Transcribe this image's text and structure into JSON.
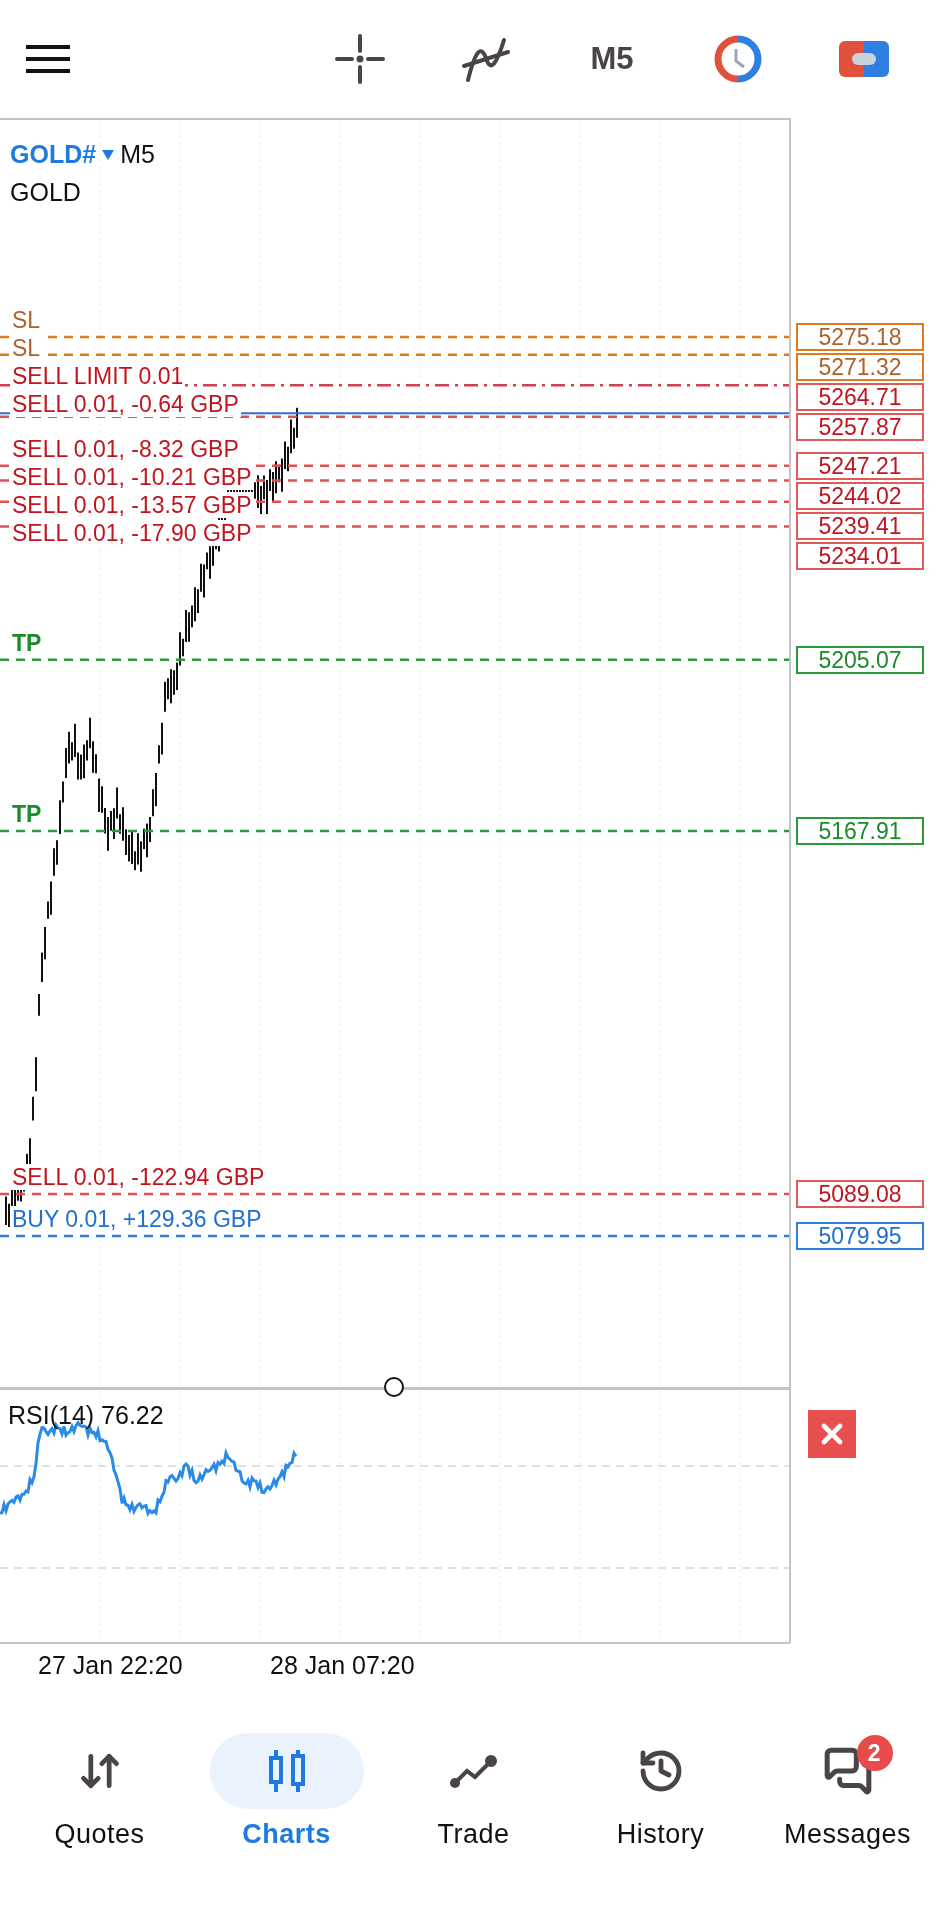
{
  "toolbar": {
    "timeframe": "M5"
  },
  "chart": {
    "symbol": "GOLD#",
    "timeframe": "M5",
    "description": "GOLD",
    "price_lines": [
      {
        "kind": "sl",
        "label": "SL",
        "price": "5275.18"
      },
      {
        "kind": "sl",
        "label": "SL",
        "price": "5271.32"
      },
      {
        "kind": "sell_limit",
        "label": "SELL LIMIT 0.01",
        "price": "5264.71"
      },
      {
        "kind": "sell",
        "label": "SELL 0.01,  -0.64 GBP",
        "price": "5257.87"
      },
      {
        "kind": "sell",
        "label": "SELL 0.01,  -8.32 GBP",
        "price": "5247.21"
      },
      {
        "kind": "sell",
        "label": "SELL 0.01,  -10.21 GBP",
        "price": "5244.02"
      },
      {
        "kind": "sell",
        "label": "SELL 0.01,  -13.57 GBP",
        "price": "5239.41"
      },
      {
        "kind": "sell",
        "label": "SELL 0.01,  -17.90 GBP",
        "price": "5234.01"
      },
      {
        "kind": "tp",
        "label": "TP",
        "price": "5205.07"
      },
      {
        "kind": "tp",
        "label": "TP",
        "price": "5167.91"
      },
      {
        "kind": "sell",
        "label": "SELL 0.01,  -122.94 GBP",
        "price": "5089.08"
      },
      {
        "kind": "buy",
        "label": "BUY 0.01,  +129.36 GBP",
        "price": "5079.95"
      }
    ],
    "indicator": {
      "label": "RSI(14) 76.22"
    },
    "time_labels": [
      "27 Jan 22:20",
      "28 Jan 07:20"
    ]
  },
  "nav": [
    {
      "kind": "quotes",
      "label": "Quotes",
      "selected": false
    },
    {
      "kind": "charts",
      "label": "Charts",
      "selected": true
    },
    {
      "kind": "trade",
      "label": "Trade",
      "selected": false
    },
    {
      "kind": "history",
      "label": "History",
      "selected": false
    },
    {
      "kind": "messages",
      "label": "Messages",
      "selected": false,
      "badge": "2"
    }
  ]
}
